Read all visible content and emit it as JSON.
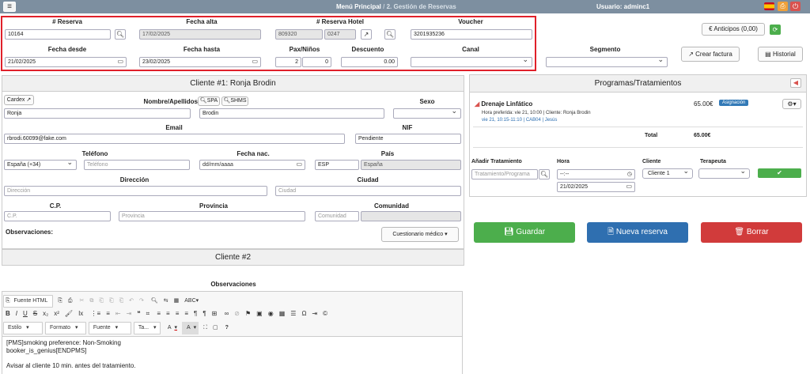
{
  "topbar": {
    "menu_icon": "hamburger-icon",
    "crumb_main": "Menú Principal",
    "crumb_sep": "/",
    "crumb_current": "2. Gestión de Reservas",
    "user": "Usuario: adminc1",
    "icons": [
      "spain-flag-icon",
      "printer-icon",
      "power-icon"
    ]
  },
  "reserva": {
    "labels": {
      "reserva": "# Reserva",
      "fecha_alta": "Fecha alta",
      "reserva_hotel": "# Reserva Hotel",
      "voucher": "Voucher",
      "fecha_desde": "Fecha desde",
      "fecha_hasta": "Fecha hasta",
      "pax": "Pax/Niños",
      "descuento": "Descuento",
      "canal": "Canal",
      "segmento": "Segmento"
    },
    "reserva_num": "10164",
    "fecha_alta": "17/02/2025",
    "hotel_num": "809320",
    "hotel_sub": "0247",
    "voucher": "3201935236",
    "fecha_desde": "21/02/2025",
    "fecha_hasta": "23/02/2025",
    "pax": "2",
    "ninos": "0",
    "descuento": "0.00",
    "canal": "",
    "segmento": ""
  },
  "actions": {
    "anticipos": "€ Anticipos (0,00)",
    "crear_factura": "Crear factura",
    "historial": "Historial"
  },
  "cliente1": {
    "title": "Cliente #1: Ronja Brodin",
    "cardex": "Cardex",
    "labels": {
      "nombre": "Nombre/Apellidos",
      "spa": "SPA",
      "shms": "SHMS",
      "sexo": "Sexo",
      "email": "Email",
      "nif": "NIF",
      "telefono": "Teléfono",
      "fecha_nac": "Fecha nac.",
      "pais": "País",
      "direccion": "Dirección",
      "ciudad": "Ciudad",
      "cp": "C.P.",
      "provincia": "Provincia",
      "comunidad": "Comunidad",
      "observaciones": "Observaciones:"
    },
    "nombre": "Ronja",
    "apellidos": "Brodin",
    "sexo": "",
    "email": "rbrodi.60099@fake.com",
    "nif": "Pendiente",
    "telefono_prefix": "España (+34)",
    "telefono_ph": "Teléfono",
    "fecha_nac_ph": "dd/mm/aaaa",
    "pais_code": "ESP",
    "pais_name": "España",
    "direccion_ph": "Dirección",
    "ciudad_ph": "Ciudad",
    "cp_ph": "C.P.",
    "provincia_ph": "Provincia",
    "comunidad_ph": "Comunidad",
    "cuestionario": "Cuestionario médico ▾"
  },
  "cliente2": {
    "title": "Cliente #2"
  },
  "observaciones": {
    "title": "Observaciones",
    "toolbar1": [
      "Fuente HTML",
      "⎘",
      "⎙",
      "✂",
      "⧉",
      "📋",
      "📋",
      "📋",
      "↶",
      "↷",
      "🔍",
      "⇆",
      "▦",
      "ABC"
    ],
    "toolbar2": [
      "B",
      "I",
      "U",
      "S",
      "x₂",
      "x²",
      "𝑓",
      "Ix",
      "⋮≡",
      "≡",
      "⇤",
      "⇥",
      "❝",
      "⌗",
      "≡",
      "≡",
      "≡",
      "≡",
      "¶",
      "¶",
      "⊞",
      "∞",
      "⊘",
      "⚑",
      "▣",
      "◉",
      "▦",
      "☰",
      "Ω",
      "⇥",
      "©"
    ],
    "toolbar3": {
      "estilo": "Estilo",
      "formato": "Formato",
      "fuente": "Fuente",
      "tamano": "Ta...",
      "color_a": "A",
      "color_b": "A",
      "maximize": "⛶",
      "blocks": "▢",
      "help": "?"
    },
    "content": [
      "[PMS]smoking preference: Non-Smoking",
      "booker_is_genius[ENDPMS]",
      "Avisar al cliente 10 min. antes del tratamiento."
    ]
  },
  "programas": {
    "title": "Programas/Tratamientos",
    "treatment": {
      "name": "Drenaje Linfático",
      "price": "65.00€",
      "badge": "Asignación",
      "line1": "Hora preferida: vie 21, 10:00 | Cliente: Ronja Brodin",
      "line2": "vie 21, 10:15-11:10 | CAB04 | Jesús"
    },
    "total_label": "Total",
    "total_value": "65.00€",
    "add": {
      "labels": {
        "tratamiento": "Añadir Tratamiento",
        "hora": "Hora",
        "cliente": "Cliente",
        "terapeuta": "Terapeuta"
      },
      "tratamiento_ph": "Tratamiento/Programa",
      "hora": "--:--",
      "fecha": "21/02/2025",
      "cliente": "Cliente 1",
      "terapeuta": ""
    }
  },
  "bottom_buttons": {
    "guardar": "Guardar",
    "nueva": "Nueva reserva",
    "borrar": "Borrar"
  },
  "colors": {
    "topbar": "#7d8fa0",
    "green": "#4cae4c",
    "blue": "#2f6fb0",
    "red": "#d13b3b",
    "highlight": "#e0202a"
  }
}
